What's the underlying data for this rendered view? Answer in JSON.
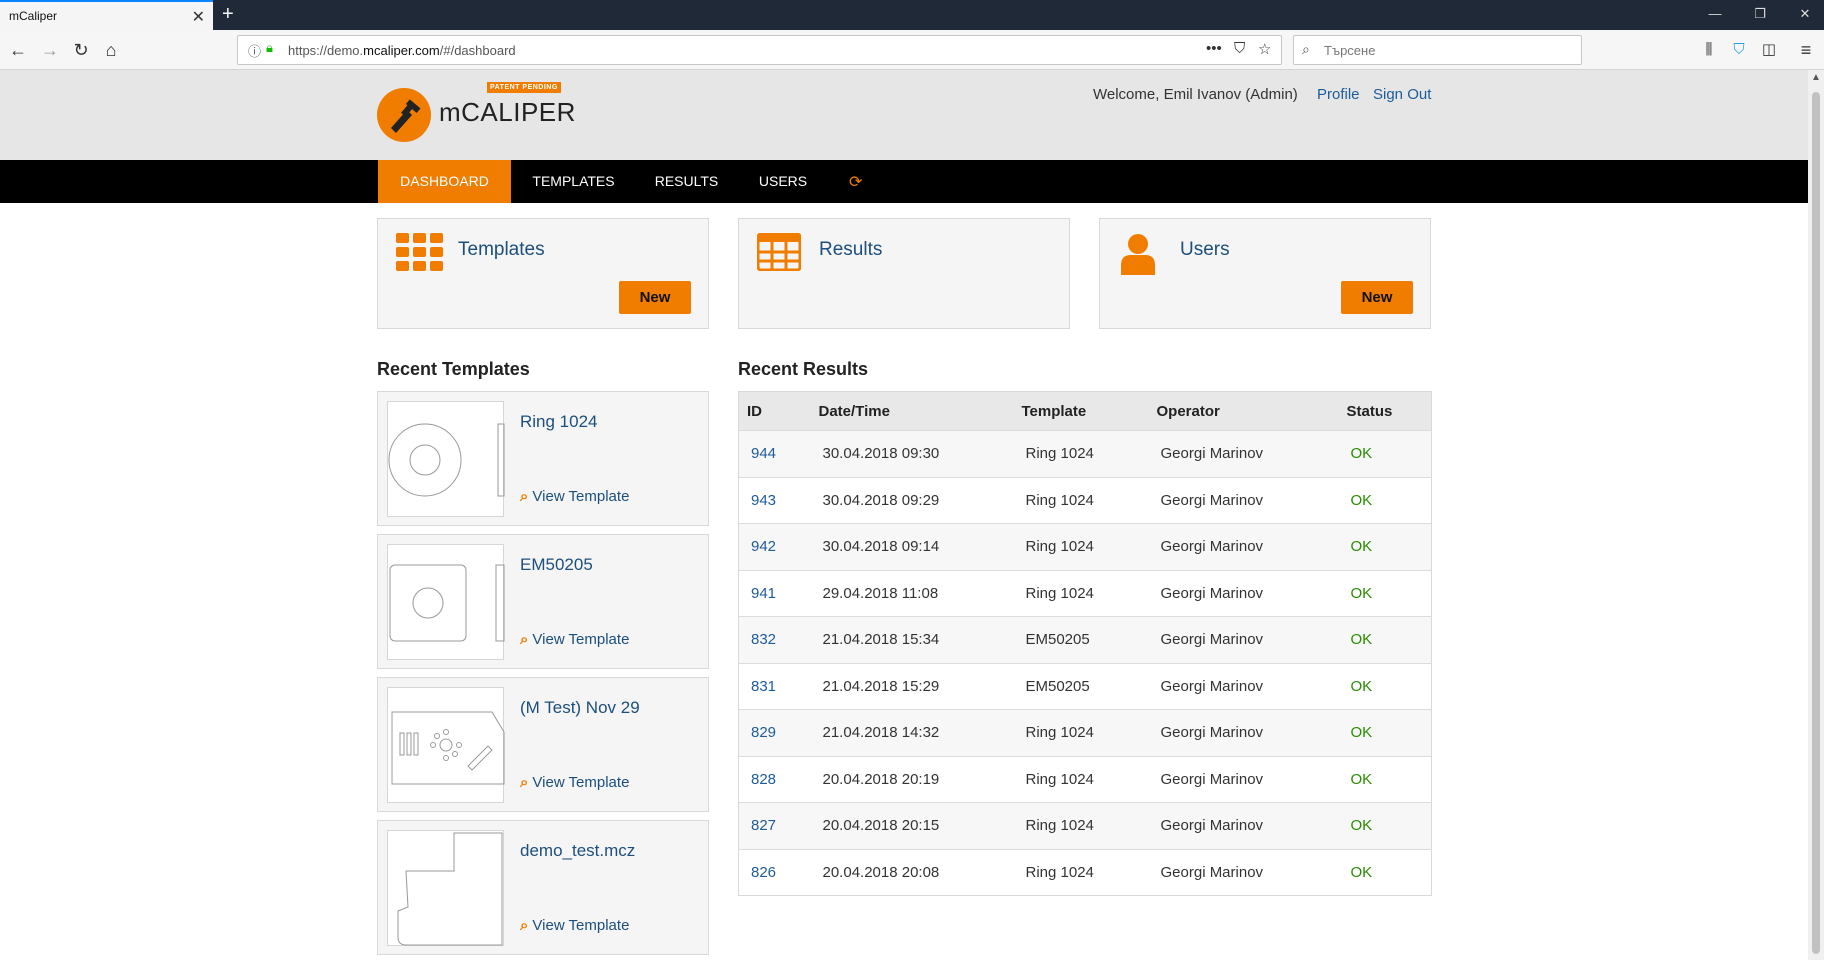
{
  "browser": {
    "tab_title": "mCaliper",
    "url_prefix": "https://demo.",
    "url_domain": "mcaliper.com",
    "url_suffix": "/#/dashboard",
    "search_placeholder": "Търсене"
  },
  "header": {
    "brand": "mCALIPER",
    "patent": "PATENT PENDING",
    "welcome": "Welcome, Emil Ivanov (Admin)",
    "profile": "Profile",
    "sign_out": "Sign Out"
  },
  "menu": {
    "dashboard": "DASHBOARD",
    "templates": "TEMPLATES",
    "results": "RESULTS",
    "users": "USERS"
  },
  "cards": {
    "templates": {
      "title": "Templates",
      "button": "New"
    },
    "results": {
      "title": "Results"
    },
    "users": {
      "title": "Users",
      "button": "New"
    }
  },
  "recent_templates": {
    "title": "Recent Templates",
    "view_label": "View Template",
    "items": [
      {
        "name": "Ring 1024"
      },
      {
        "name": "EM50205"
      },
      {
        "name": "(M Test) Nov 29"
      },
      {
        "name": "demo_test.mcz"
      }
    ]
  },
  "recent_results": {
    "title": "Recent Results",
    "columns": [
      "ID",
      "Date/Time",
      "Template",
      "Operator",
      "Status"
    ],
    "rows": [
      {
        "id": "944",
        "datetime": "30.04.2018 09:30",
        "template": "Ring 1024",
        "operator": "Georgi Marinov",
        "status": "OK"
      },
      {
        "id": "943",
        "datetime": "30.04.2018 09:29",
        "template": "Ring 1024",
        "operator": "Georgi Marinov",
        "status": "OK"
      },
      {
        "id": "942",
        "datetime": "30.04.2018 09:14",
        "template": "Ring 1024",
        "operator": "Georgi Marinov",
        "status": "OK"
      },
      {
        "id": "941",
        "datetime": "29.04.2018 11:08",
        "template": "Ring 1024",
        "operator": "Georgi Marinov",
        "status": "OK"
      },
      {
        "id": "832",
        "datetime": "21.04.2018 15:34",
        "template": "EM50205",
        "operator": "Georgi Marinov",
        "status": "OK"
      },
      {
        "id": "831",
        "datetime": "21.04.2018 15:29",
        "template": "EM50205",
        "operator": "Georgi Marinov",
        "status": "OK"
      },
      {
        "id": "829",
        "datetime": "21.04.2018 14:32",
        "template": "Ring 1024",
        "operator": "Georgi Marinov",
        "status": "OK"
      },
      {
        "id": "828",
        "datetime": "20.04.2018 20:19",
        "template": "Ring 1024",
        "operator": "Georgi Marinov",
        "status": "OK"
      },
      {
        "id": "827",
        "datetime": "20.04.2018 20:15",
        "template": "Ring 1024",
        "operator": "Georgi Marinov",
        "status": "OK"
      },
      {
        "id": "826",
        "datetime": "20.04.2018 20:08",
        "template": "Ring 1024",
        "operator": "Georgi Marinov",
        "status": "OK"
      }
    ]
  },
  "colors": {
    "accent": "#f07d00",
    "link": "#1d4f7c",
    "ok": "#2a8c00"
  }
}
